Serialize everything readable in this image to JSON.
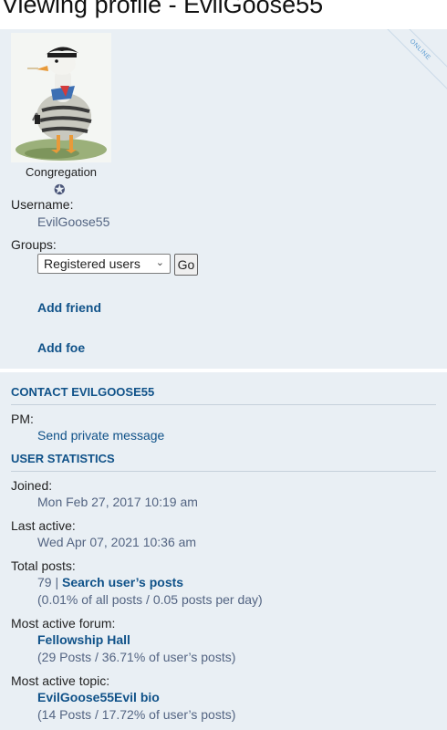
{
  "page": {
    "title": "Viewing profile - EvilGoose55"
  },
  "profile": {
    "online_badge": "ONLINE",
    "rank_title": "Congregation",
    "username_label": "Username:",
    "username": "EvilGoose55",
    "groups_label": "Groups:",
    "groups_selected": "Registered users",
    "go_label": "Go",
    "add_friend": "Add friend",
    "add_foe": "Add foe"
  },
  "contact": {
    "heading": "CONTACT EVILGOOSE55",
    "pm_label": "PM:",
    "pm_link": "Send private message"
  },
  "stats": {
    "heading": "USER STATISTICS",
    "joined_label": "Joined:",
    "joined": "Mon Feb 27, 2017 10:19 am",
    "last_active_label": "Last active:",
    "last_active": "Wed Apr 07, 2021 10:36 am",
    "total_posts_label": "Total posts:",
    "total_posts": "79",
    "total_posts_sep": " | ",
    "search_link": "Search user’s posts",
    "posts_detail": "(0.01% of all posts / 0.05 posts per day)",
    "active_forum_label": "Most active forum:",
    "active_forum": "Fellowship Hall",
    "active_forum_detail": "(29 Posts / 36.71% of user’s posts)",
    "active_topic_label": "Most active topic:",
    "active_topic": "EvilGoose55Evil bio",
    "active_topic_detail": "(14 Posts / 17.72% of user’s posts)"
  }
}
